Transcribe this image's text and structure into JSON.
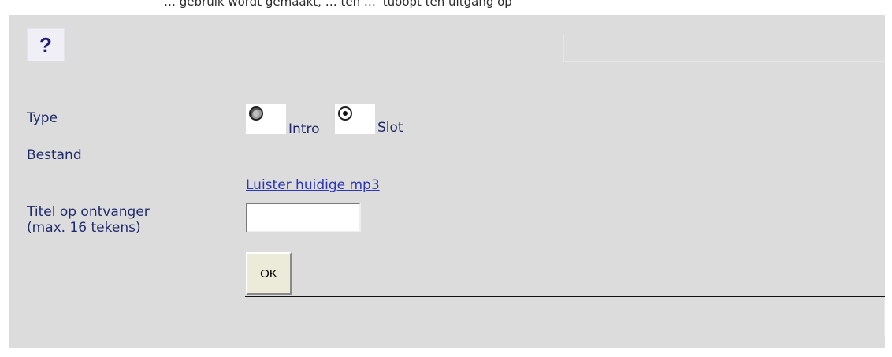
{
  "top_text": "… gebruik wordt gemaakt, … ten … 'tuoopt ten uitgang op",
  "help_icon": "question-mark-icon",
  "form": {
    "type_label": "Type",
    "type_options": [
      "Intro",
      "Slot"
    ],
    "type_selected": "Slot",
    "file_label": "Bestand",
    "listen_link": "Luister huidige mp3",
    "title_label_line1": "Titel op ontvanger",
    "title_label_line2": "(max. 16 tekens)",
    "title_value": "",
    "ok_button": "OK"
  }
}
